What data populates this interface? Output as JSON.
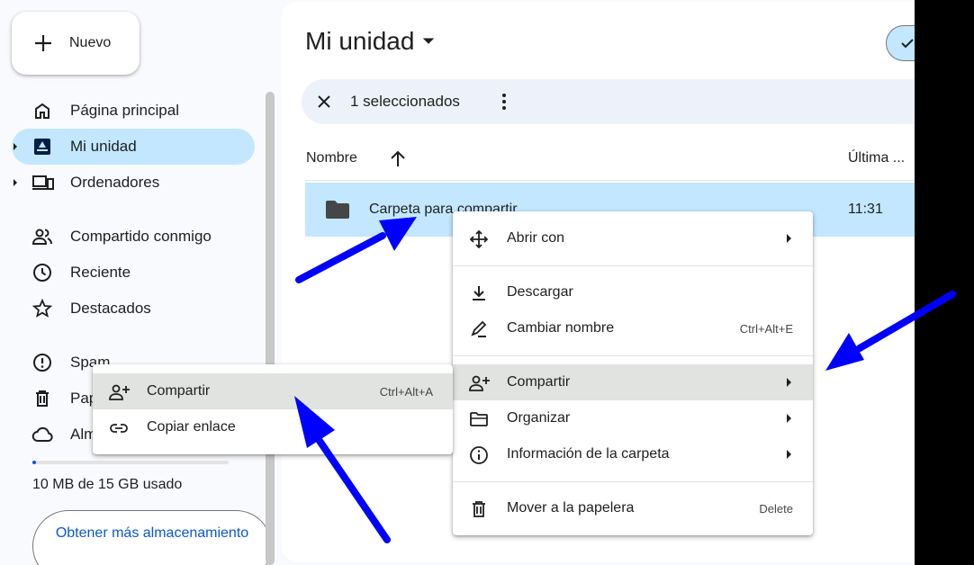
{
  "sidebar": {
    "new_button": "Nuevo",
    "items": [
      {
        "label": "Página principal",
        "icon": "home-icon"
      },
      {
        "label": "Mi unidad",
        "icon": "drive-icon"
      },
      {
        "label": "Ordenadores",
        "icon": "computers-icon"
      },
      {
        "label": "Compartido conmigo",
        "icon": "shared-icon"
      },
      {
        "label": "Reciente",
        "icon": "clock-icon"
      },
      {
        "label": "Destacados",
        "icon": "star-icon"
      },
      {
        "label": "Spam",
        "icon": "spam-icon"
      },
      {
        "label": "Papelera",
        "icon": "trash-icon"
      },
      {
        "label": "Almacenamiento",
        "icon": "cloud-icon"
      }
    ],
    "storage_text": "10 MB de 15 GB usado",
    "storage_used_fraction": 0.0007,
    "get_storage": "Obtener más almacenamiento"
  },
  "main": {
    "title": "Mi unidad",
    "selection": "1 seleccionados",
    "columns": {
      "name": "Nombre",
      "modified": "Última ..."
    },
    "row": {
      "name": "Carpeta para compartir",
      "time": "11:31"
    }
  },
  "context_menu": [
    {
      "label": "Abrir con",
      "icon": "open-with-icon",
      "arrow": true
    },
    {
      "label": "Descargar",
      "icon": "download-icon"
    },
    {
      "label": "Cambiar nombre",
      "icon": "rename-icon",
      "shortcut": "Ctrl+Alt+E"
    },
    {
      "label": "Compartir",
      "icon": "share-icon",
      "arrow": true,
      "highlighted": true
    },
    {
      "label": "Organizar",
      "icon": "organize-icon",
      "arrow": true
    },
    {
      "label": "Información de la carpeta",
      "icon": "info-icon",
      "arrow": true
    },
    {
      "label": "Mover a la papelera",
      "icon": "trash-icon",
      "shortcut": "Delete"
    }
  ],
  "submenu": [
    {
      "label": "Compartir",
      "icon": "share-icon",
      "shortcut": "Ctrl+Alt+A",
      "highlighted": true
    },
    {
      "label": "Copiar enlace",
      "icon": "link-icon"
    }
  ],
  "colors": {
    "accent": "#0b57d0",
    "selected": "#c2e7ff",
    "annotation_arrow": "#0000ff"
  }
}
